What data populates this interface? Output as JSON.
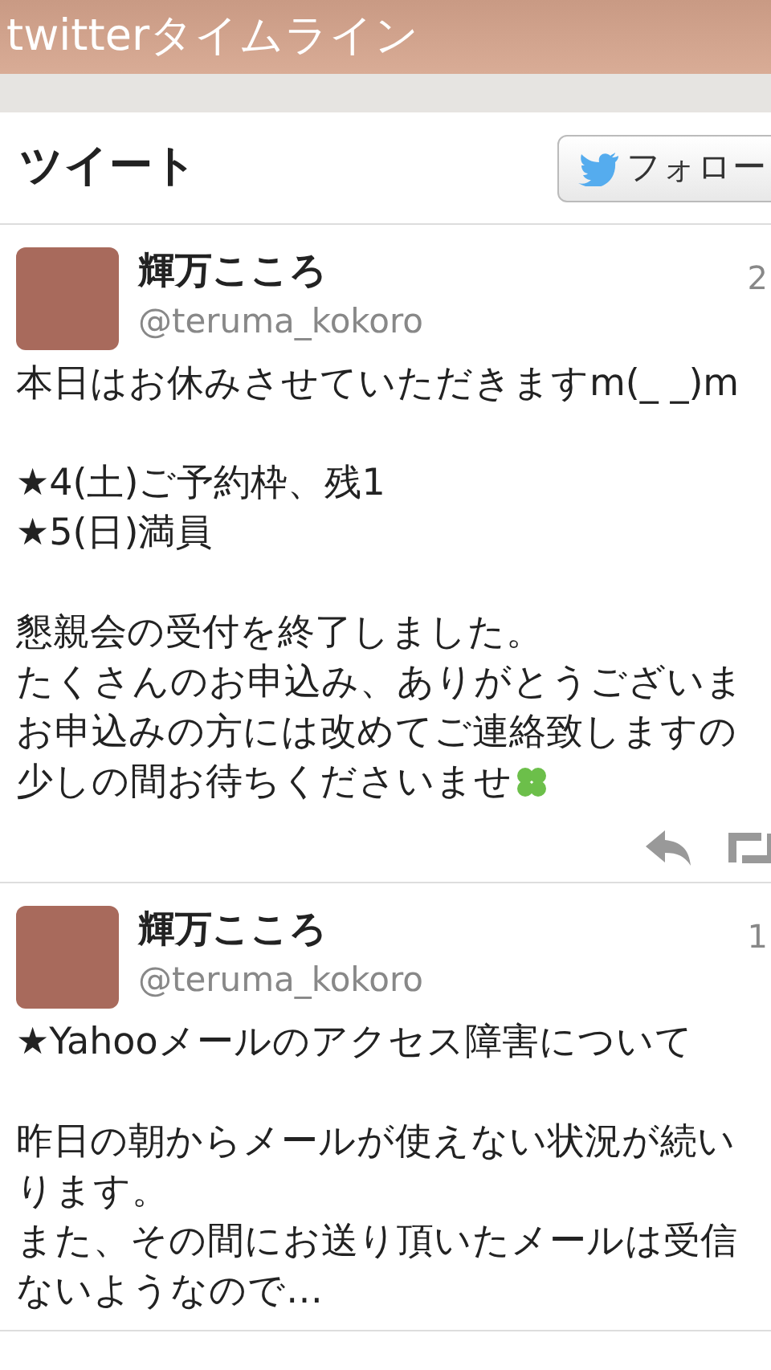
{
  "header": {
    "title": "twitterタイムライン"
  },
  "timeline": {
    "title": "ツイート",
    "follow_button": "フォロー"
  },
  "tweets": [
    {
      "name": "輝万こころ",
      "handle": "@teruma_kokoro",
      "time": "2",
      "paragraphs": [
        [
          "本日はお休みさせていただきますm(_ _)m"
        ],
        [
          "★4(土)ご予約枠、残1",
          "★5(日)満員"
        ],
        [
          "懇親会の受付を終了しました。",
          "たくさんのお申込み、ありがとうございま",
          "お申込みの方には改めてご連絡致しますの",
          "少しの間お待ちくださいませ"
        ]
      ],
      "ends_with_clover": true,
      "show_actions": true
    },
    {
      "name": "輝万こころ",
      "handle": "@teruma_kokoro",
      "time": "1",
      "paragraphs": [
        [
          "★Yahooメールのアクセス障害について"
        ],
        [
          "昨日の朝からメールが使えない状況が続い",
          "ります。",
          "また、その間にお送り頂いたメールは受信",
          "ないようなので…"
        ]
      ],
      "ends_with_clover": false,
      "show_actions": false
    }
  ]
}
